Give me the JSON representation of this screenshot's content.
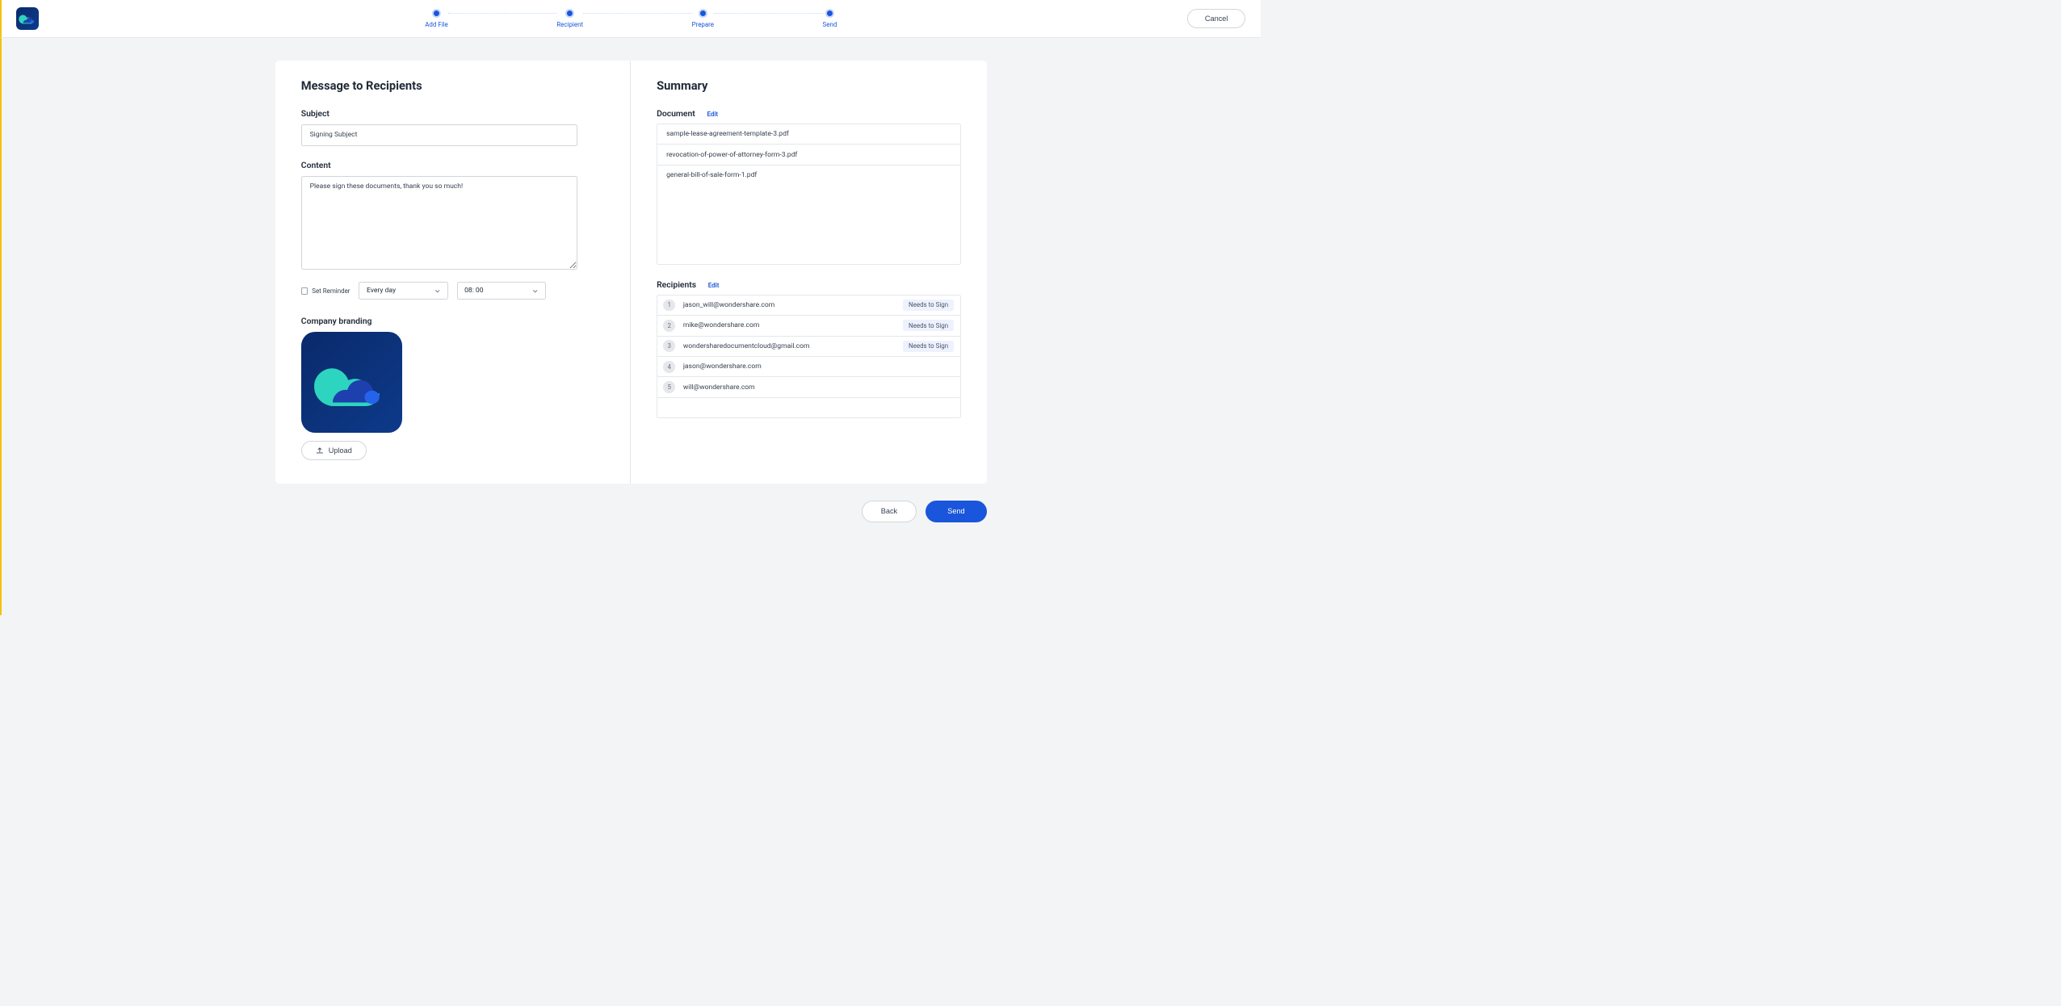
{
  "header": {
    "steps": [
      "Add File",
      "Recipient",
      "Prepare",
      "Send"
    ],
    "cancel": "Cancel"
  },
  "left": {
    "title": "Message to Recipients",
    "subject_label": "Subject",
    "subject_value": "Signing Subject",
    "content_label": "Content",
    "content_value": "Please sign these documents, thank you so much!",
    "set_reminder_label": "Set Reminder",
    "frequency": "Every day",
    "time": "08: 00",
    "branding_label": "Company branding",
    "upload_label": "Upload"
  },
  "right": {
    "title": "Summary",
    "document_label": "Document",
    "edit": "Edit",
    "documents": [
      "sample-lease-agreement-template-3.pdf",
      "revocation-of-power-of-attorney-form-3.pdf",
      "general-bill-of-sale-form-1.pdf"
    ],
    "recipients_label": "Recipients",
    "recipients": [
      {
        "n": "1",
        "email": "jason_will@wondershare.com",
        "badge": "Needs to Sign"
      },
      {
        "n": "2",
        "email": "mike@wondershare.com",
        "badge": "Needs to Sign"
      },
      {
        "n": "3",
        "email": "wondersharedocumentcloud@gmail.com",
        "badge": "Needs to Sign"
      },
      {
        "n": "4",
        "email": "jason@wondershare.com",
        "badge": ""
      },
      {
        "n": "5",
        "email": "will@wondershare.com",
        "badge": ""
      }
    ]
  },
  "footer": {
    "back": "Back",
    "send": "Send"
  }
}
